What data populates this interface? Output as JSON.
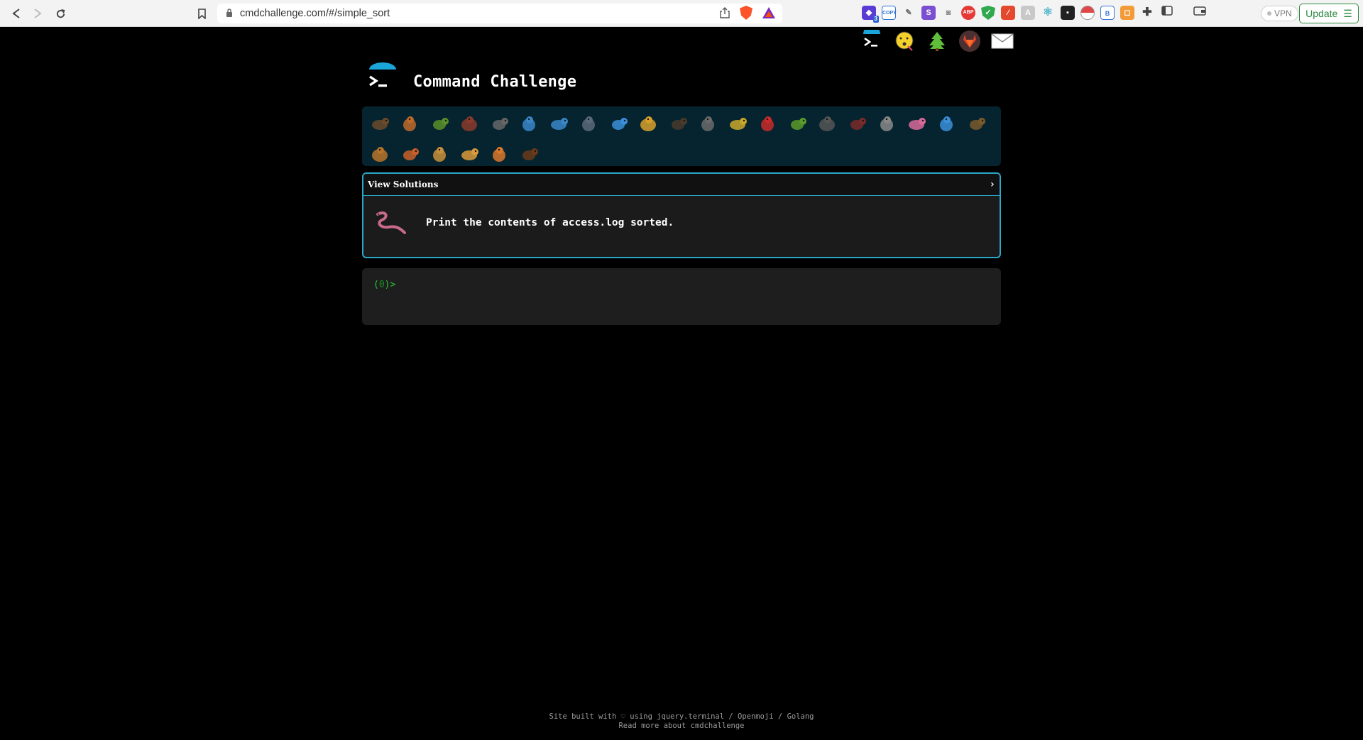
{
  "browser": {
    "url": "cmdchallenge.com/#/simple_sort",
    "extensions": [
      {
        "icon": "stack-icon",
        "color": "#5b3bd6",
        "badge": "3"
      },
      {
        "icon": "copy-icon",
        "color": "#2b72d6",
        "badge": "COPY"
      },
      {
        "icon": "eyedropper-icon",
        "color": "#7a7a7a"
      },
      {
        "icon": "s-icon",
        "color": "#7b4fd1",
        "text": "S"
      },
      {
        "icon": "camera-icon",
        "color": "#8a8a8a"
      },
      {
        "icon": "adblock-icon",
        "color": "#e53935",
        "text": "ABP"
      },
      {
        "icon": "shield-icon",
        "color": "#2fa84f"
      },
      {
        "icon": "pdf-icon",
        "color": "#e5492d"
      },
      {
        "icon": "translate-icon",
        "color": "#b8b8b8"
      },
      {
        "icon": "react-icon",
        "color": "#4cb3c7"
      },
      {
        "icon": "dark-square-icon",
        "color": "#222222"
      },
      {
        "icon": "pokeball-icon",
        "color": "#e04848"
      },
      {
        "icon": "bitwarden-icon",
        "color": "#3b73d9"
      },
      {
        "icon": "orange-square-icon",
        "color": "#f29b38"
      },
      {
        "icon": "puzzle-icon",
        "color": "#555555"
      },
      {
        "icon": "sidebar-icon",
        "color": "#555555"
      },
      {
        "icon": "wallet-icon",
        "color": "#555555"
      }
    ],
    "vpn_label": "VPN",
    "update_label": "Update"
  },
  "top_links": [
    {
      "icon": "terminal-icon"
    },
    {
      "icon": "kiss-face-icon"
    },
    {
      "icon": "tree-icon"
    },
    {
      "icon": "gitlab-icon"
    },
    {
      "icon": "envelope-icon"
    }
  ],
  "site": {
    "title": "Command Challenge"
  },
  "challenges": [
    {
      "name": "snail",
      "color": "#6b4a2b"
    },
    {
      "name": "butterfly",
      "color": "#c06a2a"
    },
    {
      "name": "caterpillar",
      "color": "#5a8f2a"
    },
    {
      "name": "ant",
      "color": "#8a3a2a"
    },
    {
      "name": "spider-web",
      "color": "#666666"
    },
    {
      "name": "whale",
      "color": "#3a86c8"
    },
    {
      "name": "dolphin",
      "color": "#3a86c8"
    },
    {
      "name": "shark",
      "color": "#5a6a7a"
    },
    {
      "name": "fish",
      "color": "#3a8fd8"
    },
    {
      "name": "tropical-fish",
      "color": "#d8a02a"
    },
    {
      "name": "otter",
      "color": "#4a3a2a"
    },
    {
      "name": "wolf",
      "color": "#6a6a6a"
    },
    {
      "name": "bee",
      "color": "#c8a82a"
    },
    {
      "name": "ladybug",
      "color": "#c82a2a"
    },
    {
      "name": "lizard",
      "color": "#5a9a2a"
    },
    {
      "name": "mosquito",
      "color": "#555555"
    },
    {
      "name": "scorpion",
      "color": "#7a2a2a"
    },
    {
      "name": "fly",
      "color": "#888888"
    },
    {
      "name": "worm",
      "color": "#d86a9a"
    },
    {
      "name": "microbe",
      "color": "#3a8fd8"
    },
    {
      "name": "monkey",
      "color": "#7a5a2a"
    },
    {
      "name": "dog",
      "color": "#b8742a"
    },
    {
      "name": "fox",
      "color": "#c8602a"
    },
    {
      "name": "cat",
      "color": "#c8903a"
    },
    {
      "name": "lion",
      "color": "#d89a3a"
    },
    {
      "name": "tiger",
      "color": "#d8782a"
    },
    {
      "name": "horse",
      "color": "#6a3a1a"
    }
  ],
  "panel": {
    "header_label": "View Solutions",
    "task_icon": "worm-icon",
    "task_text": "Print the contents of access.log sorted."
  },
  "terminal": {
    "prompt_open": "(",
    "prompt_num": "0",
    "prompt_close": ")>"
  },
  "footer": {
    "line1_prefix": "Site built with ♡ using ",
    "link_terminal": "jquery.terminal",
    "sep1": " / ",
    "link_openmoji": "Openmoji",
    "sep2": " / ",
    "link_golang": "Golang",
    "line2": "Read more about cmdchallenge"
  }
}
